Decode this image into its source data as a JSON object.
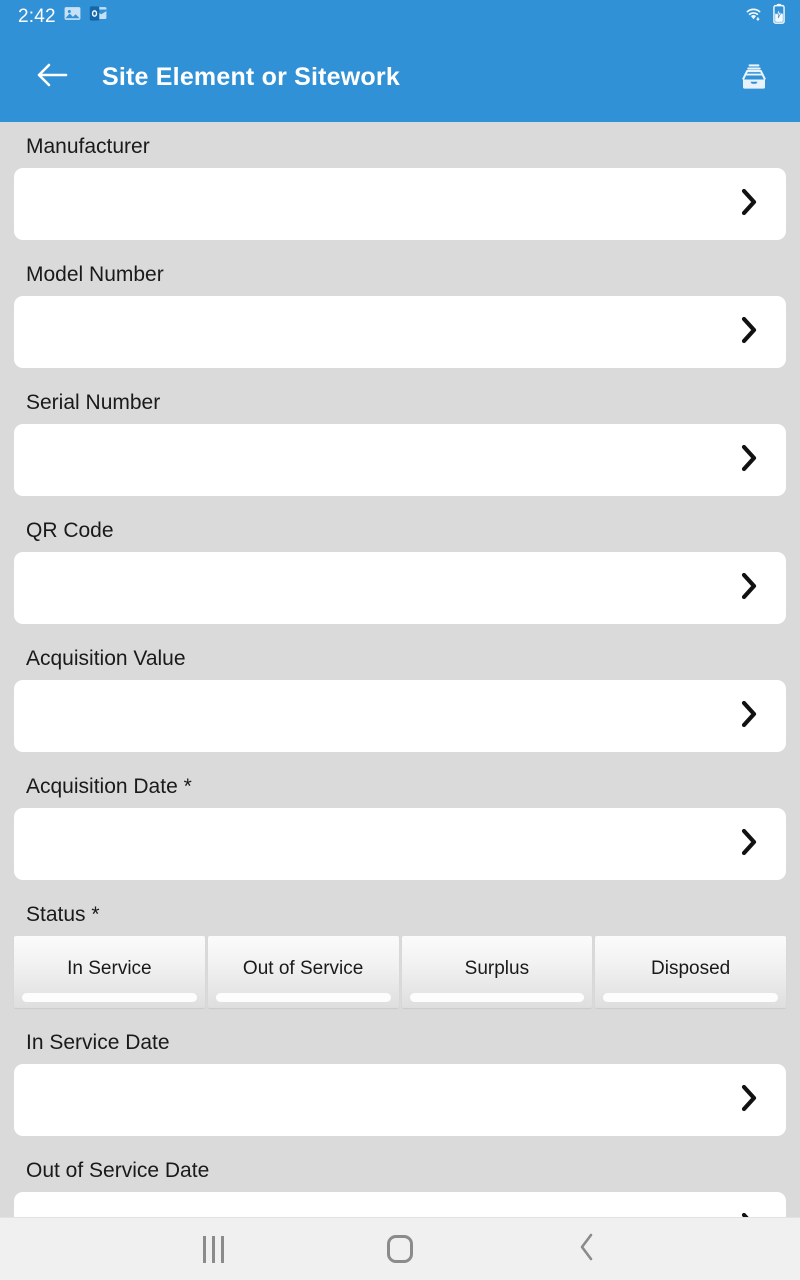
{
  "statusbar": {
    "time": "2:42",
    "left_icons": [
      {
        "name": "gallery-icon"
      },
      {
        "name": "outlook-icon"
      }
    ],
    "right_icons": [
      {
        "name": "wifi-icon"
      },
      {
        "name": "battery-charging-icon"
      }
    ]
  },
  "appbar": {
    "title": "Site Element or Sitework",
    "back_icon": "arrow-left-icon",
    "action_icon": "archive-tray-icon",
    "background": "#3191d6"
  },
  "theme": {
    "accent": "#3191d6",
    "page_background": "#dadada",
    "card_background": "#ffffff",
    "nav_background": "#f0f0f0",
    "text": "#1a1a1a"
  },
  "form": {
    "fields": [
      {
        "label": "Manufacturer",
        "value": "",
        "chevron": "chevron-right-icon"
      },
      {
        "label": "Model Number",
        "value": "",
        "chevron": "chevron-right-icon"
      },
      {
        "label": "Serial Number",
        "value": "",
        "chevron": "chevron-right-icon"
      },
      {
        "label": "QR Code",
        "value": "",
        "chevron": "chevron-right-icon"
      },
      {
        "label": "Acquisition Value",
        "value": "",
        "chevron": "chevron-right-icon"
      },
      {
        "label": "Acquisition Date *",
        "value": "",
        "chevron": "chevron-right-icon"
      }
    ],
    "status": {
      "label": "Status *",
      "options": [
        "In Service",
        "Out of Service",
        "Surplus",
        "Disposed"
      ],
      "selected": ""
    },
    "date_fields": [
      {
        "label": "In Service Date",
        "value": "",
        "chevron": "chevron-right-icon"
      },
      {
        "label": "Out of Service Date",
        "value": "",
        "chevron": "chevron-right-icon"
      }
    ]
  },
  "navbar": {
    "buttons": [
      {
        "name": "recents-button",
        "icon": "recents-icon"
      },
      {
        "name": "home-button",
        "icon": "home-icon"
      },
      {
        "name": "back-button",
        "icon": "chevron-left-icon"
      }
    ]
  }
}
